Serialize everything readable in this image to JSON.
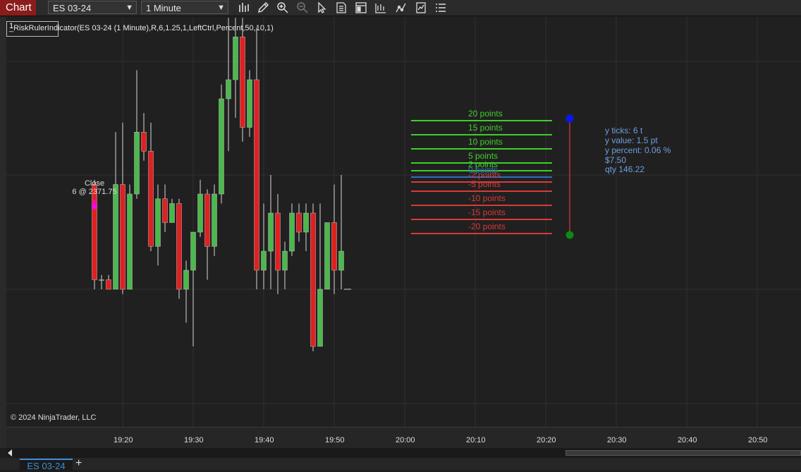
{
  "toolbar": {
    "chart_tab": "Chart",
    "instrument": "ES 03-24",
    "interval": "1 Minute",
    "tools": [
      "bars-type-icon",
      "pencil-icon",
      "zoom-in-icon",
      "zoom-out-icon",
      "pointer-icon",
      "data-box-icon",
      "properties-icon",
      "indicators-icon",
      "strategies-icon",
      "templates-icon",
      "menu-icon"
    ]
  },
  "indicator": {
    "panel_number": "1",
    "label": "_RiskRulerIndicator(ES 03-24 (1 Minute),R,6,1.25,1,LeftCtrl,Percent,50,10,1)"
  },
  "execution_marker": {
    "line1": "Close",
    "line2": "6 @ 2371.75",
    "color": "#ff00ff"
  },
  "risk_ruler": {
    "levels": [
      {
        "label": "20 points",
        "color": "#3ecf2a"
      },
      {
        "label": "15 points",
        "color": "#3ecf2a"
      },
      {
        "label": "10 points",
        "color": "#3ecf2a"
      },
      {
        "label": "5 points",
        "color": "#3ecf2a"
      },
      {
        "label": "2 points",
        "color": "#3ecf2a"
      },
      {
        "label": "0 points",
        "color": "#2e6fc4"
      },
      {
        "label": "-2 points",
        "color": "#d83a3a"
      },
      {
        "label": "-5 points",
        "color": "#d83a3a"
      },
      {
        "label": "-10 points",
        "color": "#d83a3a"
      },
      {
        "label": "-15 points",
        "color": "#d83a3a"
      },
      {
        "label": "-20 points",
        "color": "#d83a3a"
      }
    ],
    "start_dot_color": "#0a16f0",
    "end_dot_color": "#0d8a12",
    "ruler_color": "#d83a3a"
  },
  "info": {
    "y_ticks": "y ticks: 6 t",
    "y_value": "y value: 1.5 pt",
    "y_percent": "y percent: 0.06 %",
    "dollars": "$7.50",
    "qty": "qty 146.22"
  },
  "time_axis": {
    "labels": [
      "19:20",
      "19:30",
      "19:40",
      "19:50",
      "20:00",
      "20:10",
      "20:20",
      "20:30",
      "20:40",
      "20:50"
    ]
  },
  "copyright": "© 2024 NinjaTrader, LLC",
  "bottom_tabs": {
    "active_tab": "ES 03-24",
    "add_tab": "+"
  },
  "colors": {
    "up_candle": "#4cb84c",
    "down_candle": "#e02020",
    "chart_bg": "#202020",
    "grid": "#2f2f2f"
  },
  "chart_data": {
    "type": "candlestick",
    "x": [
      "19:16",
      "19:17",
      "19:18",
      "19:19",
      "19:20",
      "19:21",
      "19:22",
      "19:23",
      "19:24",
      "19:25",
      "19:26",
      "19:27",
      "19:28",
      "19:29",
      "19:30",
      "19:31",
      "19:32",
      "19:33",
      "19:34",
      "19:35",
      "19:36",
      "19:37",
      "19:38",
      "19:39",
      "19:40",
      "19:41",
      "19:42",
      "19:43",
      "19:44",
      "19:45",
      "19:46",
      "19:47",
      "19:48",
      "19:49",
      "19:50",
      "19:51"
    ],
    "ohlc": [
      [
        2371.75,
        2372.0,
        2366.25,
        2366.75
      ],
      [
        2366.75,
        2367.0,
        2366.25,
        2366.75
      ],
      [
        2366.75,
        2367.0,
        2366.25,
        2366.25
      ],
      [
        2366.25,
        2374.5,
        2366.25,
        2371.75
      ],
      [
        2371.75,
        2375.0,
        2366.0,
        2366.25
      ],
      [
        2366.25,
        2371.75,
        2366.25,
        2371.25
      ],
      [
        2371.25,
        2377.75,
        2371.0,
        2374.5
      ],
      [
        2374.5,
        2375.5,
        2373.0,
        2373.5
      ],
      [
        2373.5,
        2375.0,
        2368.25,
        2368.5
      ],
      [
        2368.5,
        2371.75,
        2367.5,
        2371.0
      ],
      [
        2371.0,
        2371.75,
        2369.25,
        2369.75
      ],
      [
        2369.75,
        2371.0,
        2369.75,
        2370.75
      ],
      [
        2370.75,
        2371.0,
        2365.75,
        2366.25
      ],
      [
        2366.25,
        2367.75,
        2364.5,
        2367.25
      ],
      [
        2367.25,
        2368.75,
        2363.25,
        2369.25
      ],
      [
        2369.25,
        2372.0,
        2369.0,
        2371.25
      ],
      [
        2371.25,
        2371.5,
        2366.75,
        2368.5
      ],
      [
        2368.5,
        2371.75,
        2368.0,
        2371.25
      ],
      [
        2371.25,
        2377.0,
        2370.75,
        2376.25
      ],
      [
        2376.25,
        2380.5,
        2373.5,
        2377.25
      ],
      [
        2377.25,
        2380.5,
        2375.25,
        2379.5
      ],
      [
        2379.5,
        2380.5,
        2374.0,
        2374.75
      ],
      [
        2374.75,
        2377.75,
        2374.25,
        2377.25
      ],
      [
        2377.25,
        2380.0,
        2366.25,
        2367.25
      ],
      [
        2367.25,
        2370.75,
        2366.25,
        2368.25
      ],
      [
        2368.25,
        2372.25,
        2366.25,
        2370.25
      ],
      [
        2370.25,
        2371.25,
        2366.0,
        2367.25
      ],
      [
        2367.25,
        2368.75,
        2366.25,
        2368.25
      ],
      [
        2368.25,
        2370.75,
        2368.0,
        2370.25
      ],
      [
        2370.25,
        2370.75,
        2368.75,
        2369.25
      ],
      [
        2369.25,
        2370.75,
        2368.25,
        2370.25
      ],
      [
        2370.25,
        2370.75,
        2363.0,
        2363.25
      ],
      [
        2363.25,
        2370.75,
        2363.25,
        2366.25
      ],
      [
        2366.25,
        2369.75,
        2366.25,
        2369.75
      ],
      [
        2369.75,
        2371.75,
        2366.0,
        2367.25
      ],
      [
        2367.25,
        2372.25,
        2366.25,
        2368.25
      ]
    ]
  }
}
